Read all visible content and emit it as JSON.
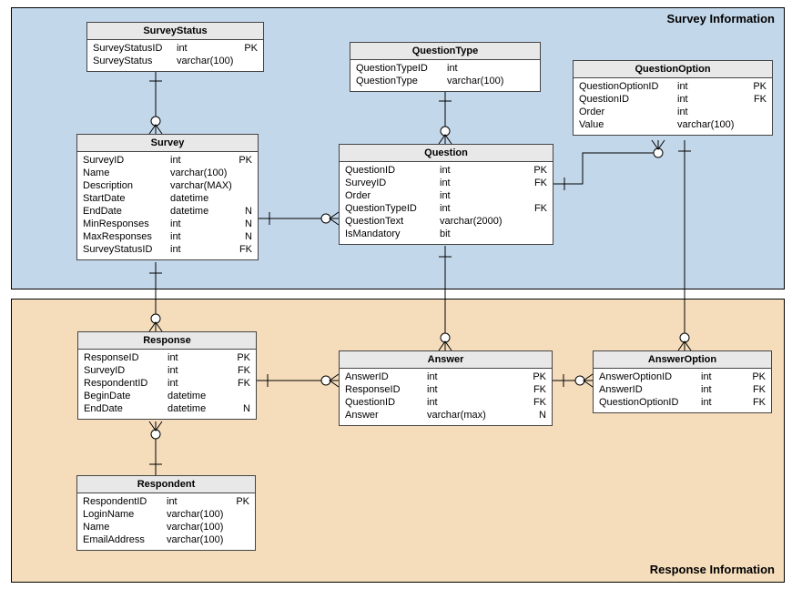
{
  "regions": {
    "survey": {
      "title": "Survey Information"
    },
    "response": {
      "title": "Response Information"
    }
  },
  "entities": {
    "surveyStatus": {
      "title": "SurveyStatus",
      "columns": [
        {
          "name": "SurveyStatusID",
          "type": "int",
          "key": "PK"
        },
        {
          "name": "SurveyStatus",
          "type": "varchar(100)",
          "key": ""
        }
      ]
    },
    "survey": {
      "title": "Survey",
      "columns": [
        {
          "name": "SurveyID",
          "type": "int",
          "key": "PK"
        },
        {
          "name": "Name",
          "type": "varchar(100)",
          "key": ""
        },
        {
          "name": "Description",
          "type": "varchar(MAX)",
          "key": ""
        },
        {
          "name": "StartDate",
          "type": "datetime",
          "key": ""
        },
        {
          "name": "EndDate",
          "type": "datetime",
          "key": "N"
        },
        {
          "name": "MinResponses",
          "type": "int",
          "key": "N"
        },
        {
          "name": "MaxResponses",
          "type": "int",
          "key": "N"
        },
        {
          "name": "SurveyStatusID",
          "type": "int",
          "key": "FK"
        }
      ]
    },
    "questionType": {
      "title": "QuestionType",
      "columns": [
        {
          "name": "QuestionTypeID",
          "type": "int",
          "key": ""
        },
        {
          "name": "QuestionType",
          "type": "varchar(100)",
          "key": ""
        }
      ]
    },
    "question": {
      "title": "Question",
      "columns": [
        {
          "name": "QuestionID",
          "type": "int",
          "key": "PK"
        },
        {
          "name": "SurveyID",
          "type": "int",
          "key": "FK"
        },
        {
          "name": "Order",
          "type": "int",
          "key": ""
        },
        {
          "name": "QuestionTypeID",
          "type": "int",
          "key": "FK"
        },
        {
          "name": "QuestionText",
          "type": "varchar(2000)",
          "key": ""
        },
        {
          "name": "IsMandatory",
          "type": "bit",
          "key": ""
        }
      ]
    },
    "questionOption": {
      "title": "QuestionOption",
      "columns": [
        {
          "name": "QuestionOptionID",
          "type": "int",
          "key": "PK"
        },
        {
          "name": "QuestionID",
          "type": "int",
          "key": "FK"
        },
        {
          "name": "Order",
          "type": "int",
          "key": ""
        },
        {
          "name": "Value",
          "type": "varchar(100)",
          "key": ""
        }
      ]
    },
    "response": {
      "title": "Response",
      "columns": [
        {
          "name": "ResponseID",
          "type": "int",
          "key": "PK"
        },
        {
          "name": "SurveyID",
          "type": "int",
          "key": "FK"
        },
        {
          "name": "RespondentID",
          "type": "int",
          "key": "FK"
        },
        {
          "name": "BeginDate",
          "type": "datetime",
          "key": ""
        },
        {
          "name": "EndDate",
          "type": "datetime",
          "key": "N"
        }
      ]
    },
    "answer": {
      "title": "Answer",
      "columns": [
        {
          "name": "AnswerID",
          "type": "int",
          "key": "PK"
        },
        {
          "name": "ResponseID",
          "type": "int",
          "key": "FK"
        },
        {
          "name": "QuestionID",
          "type": "int",
          "key": "FK"
        },
        {
          "name": "Answer",
          "type": "varchar(max)",
          "key": "N"
        }
      ]
    },
    "answerOption": {
      "title": "AnswerOption",
      "columns": [
        {
          "name": "AnswerOptionID",
          "type": "int",
          "key": "PK"
        },
        {
          "name": "AnswerID",
          "type": "int",
          "key": "FK"
        },
        {
          "name": "QuestionOptionID",
          "type": "int",
          "key": "FK"
        }
      ]
    },
    "respondent": {
      "title": "Respondent",
      "columns": [
        {
          "name": "RespondentID",
          "type": "int",
          "key": "PK"
        },
        {
          "name": "LoginName",
          "type": "varchar(100)",
          "key": ""
        },
        {
          "name": "Name",
          "type": "varchar(100)",
          "key": ""
        },
        {
          "name": "EmailAddress",
          "type": "varchar(100)",
          "key": ""
        }
      ]
    }
  }
}
